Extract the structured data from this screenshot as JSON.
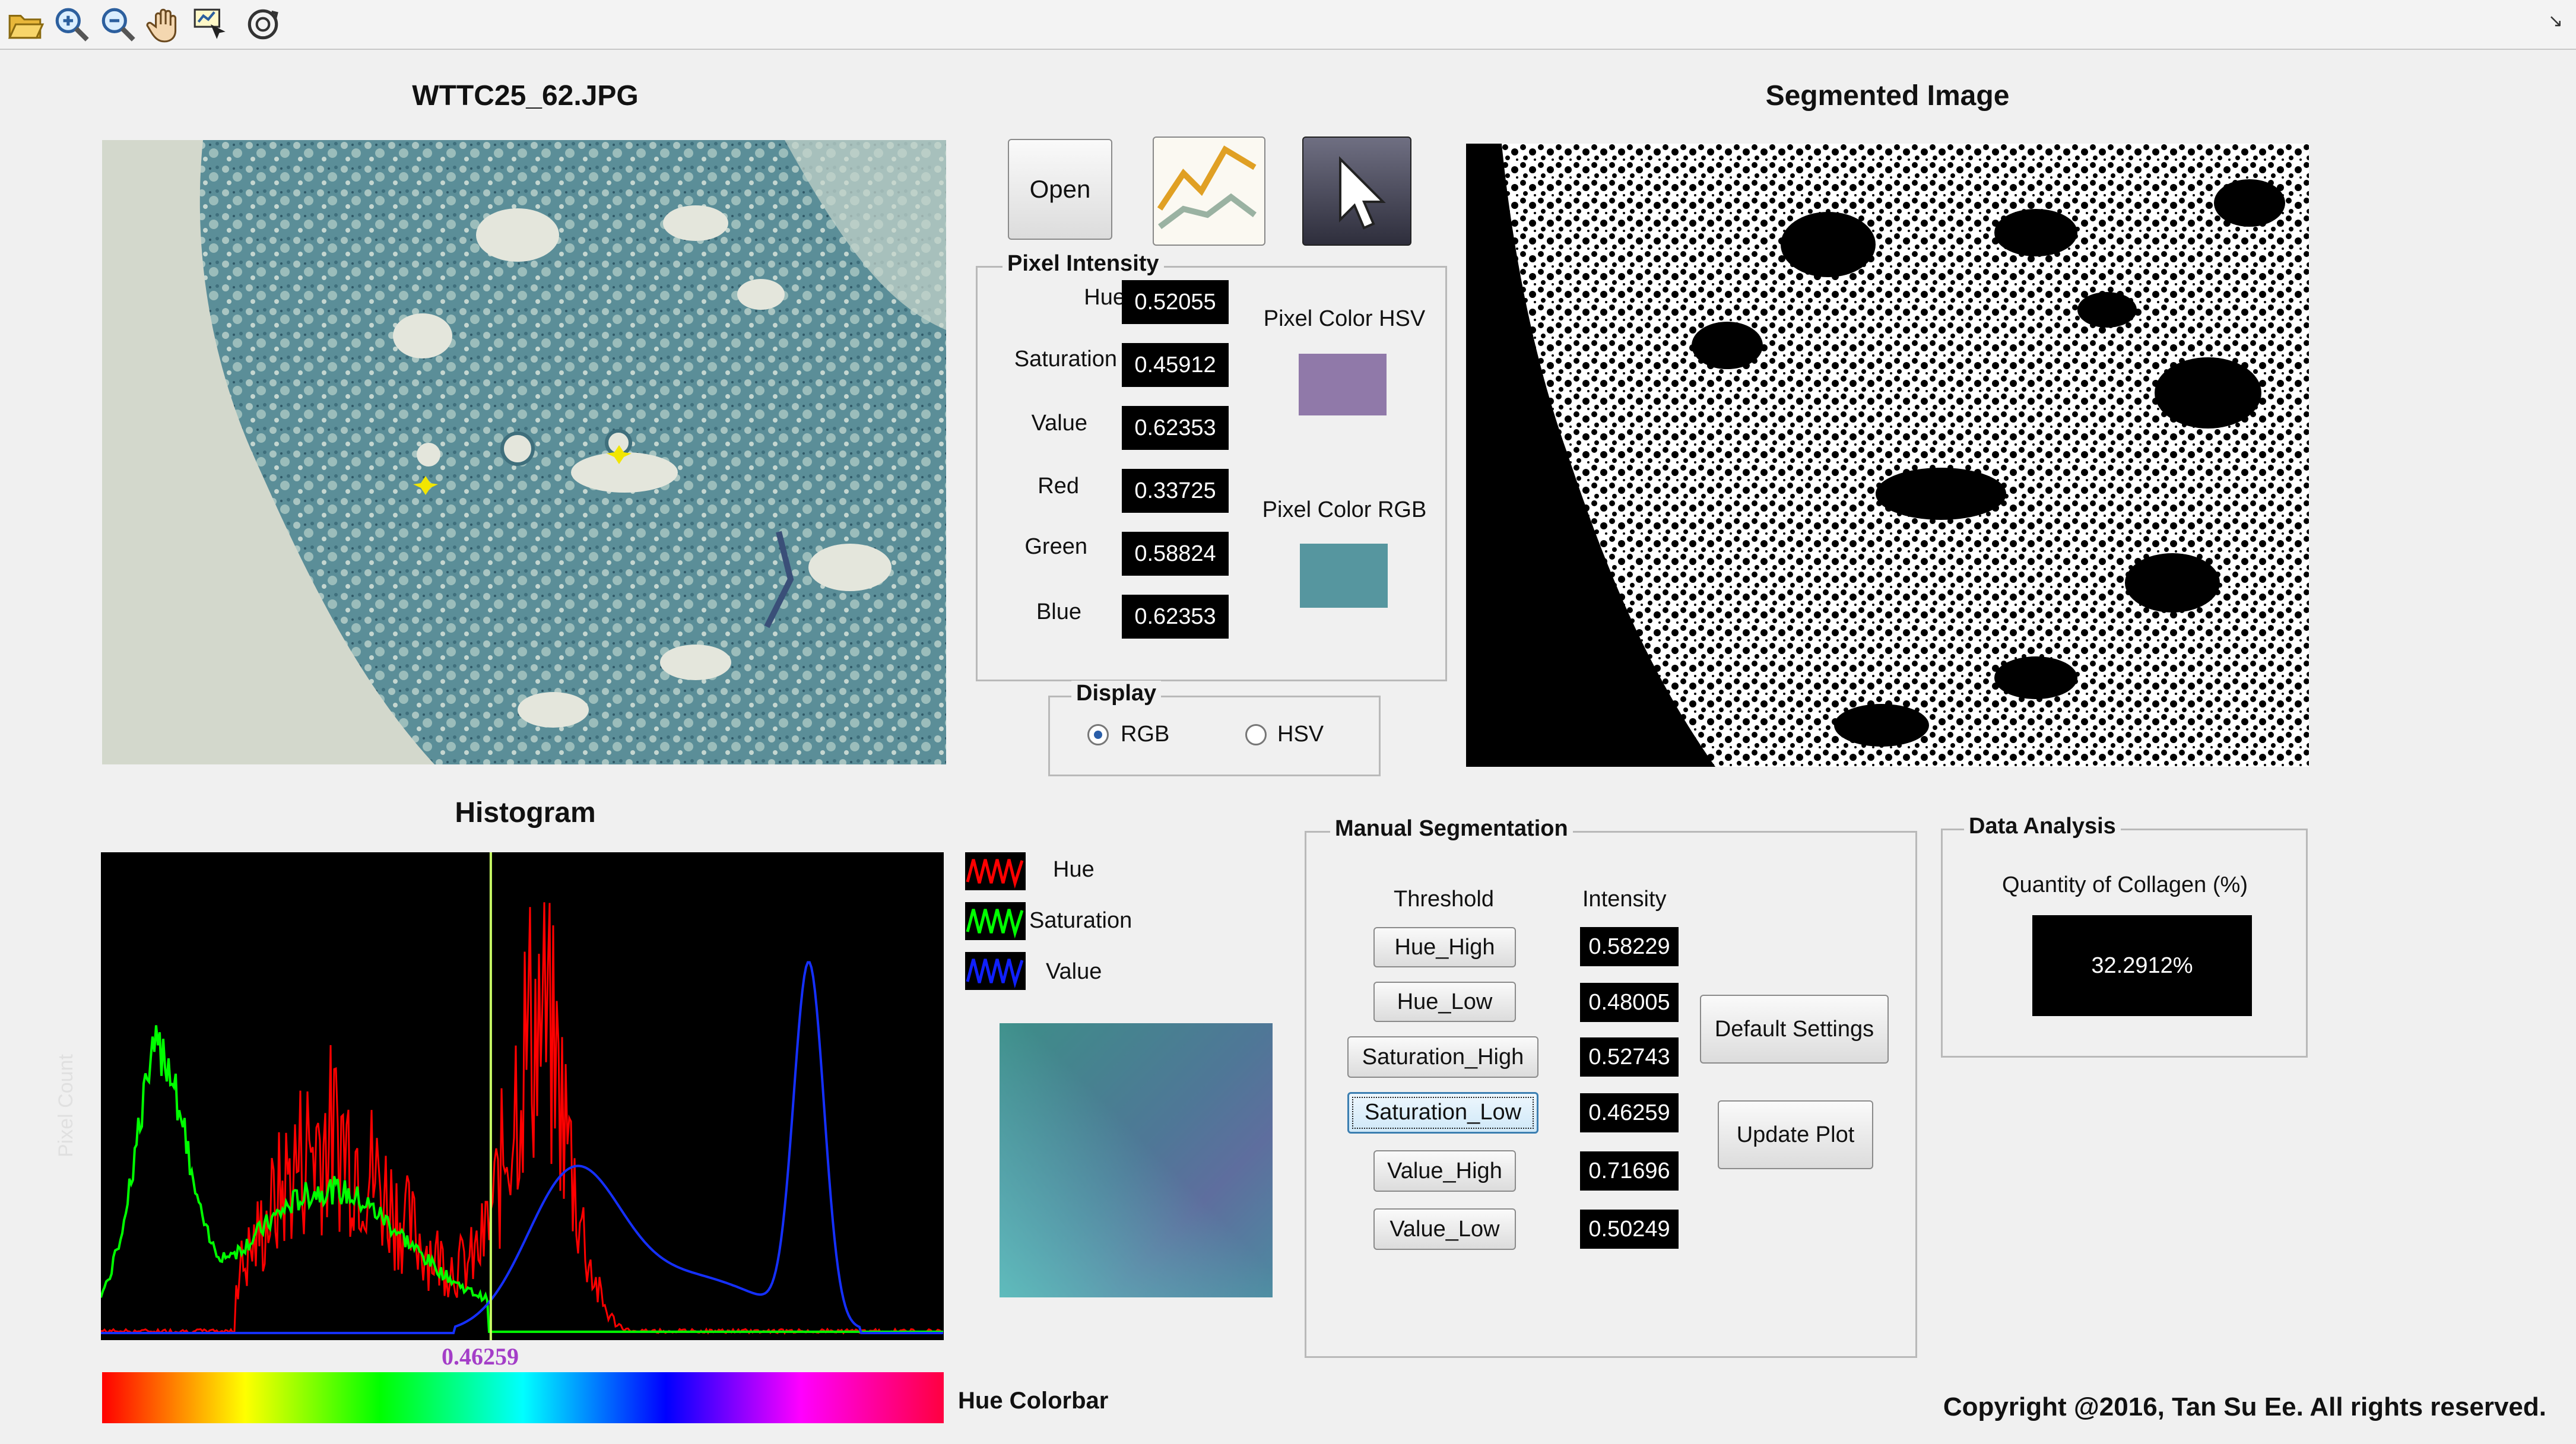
{
  "toolbar": {
    "icons": [
      "open-folder-icon",
      "zoom-in-icon",
      "zoom-out-icon",
      "pan-hand-icon",
      "data-cursor-icon",
      "rotate-3d-icon"
    ]
  },
  "original_image": {
    "title": "WTTC25_62.JPG"
  },
  "segmented_image": {
    "title": "Segmented Image"
  },
  "buttons": {
    "open_label": "Open"
  },
  "pixel_intensity": {
    "title": "Pixel Intensity",
    "rows": [
      {
        "label": "Hue",
        "value": "0.52055"
      },
      {
        "label": "Saturation",
        "value": "0.45912"
      },
      {
        "label": "Value",
        "value": "0.62353"
      },
      {
        "label": "Red",
        "value": "0.33725"
      },
      {
        "label": "Green",
        "value": "0.58824"
      },
      {
        "label": "Blue",
        "value": "0.62353"
      }
    ],
    "hsv_label": "Pixel Color HSV",
    "hsv_color": "#9079a9",
    "rgb_label": "Pixel Color RGB",
    "rgb_color": "#56969f"
  },
  "display": {
    "title": "Display",
    "option_rgb": "RGB",
    "option_hsv": "HSV",
    "selected": "RGB"
  },
  "histogram": {
    "title": "Histogram",
    "ylabel": "Pixel Count",
    "marker_value": "0.46259",
    "colorbar_label": "Hue Colorbar"
  },
  "legend": {
    "items": [
      {
        "name": "Hue",
        "color": "#ff0000"
      },
      {
        "name": "Saturation",
        "color": "#00ff00"
      },
      {
        "name": "Value",
        "color": "#0000ff"
      }
    ]
  },
  "manual_segmentation": {
    "title": "Manual Segmentation",
    "col_threshold": "Threshold",
    "col_intensity": "Intensity",
    "rows": [
      {
        "label": "Hue_High",
        "value": "0.58229"
      },
      {
        "label": "Hue_Low",
        "value": "0.48005"
      },
      {
        "label": "Saturation_High",
        "value": "0.52743"
      },
      {
        "label": "Saturation_Low",
        "value": "0.46259"
      },
      {
        "label": "Value_High",
        "value": "0.71696"
      },
      {
        "label": "Value_Low",
        "value": "0.50249"
      }
    ],
    "default_settings_label": "Default Settings",
    "update_plot_label": "Update Plot"
  },
  "data_analysis": {
    "title": "Data Analysis",
    "quantity_label": "Quantity of Collagen (%)",
    "quantity_value": "32.2912%"
  },
  "footer": {
    "copyright": "Copyright @2016, Tan Su Ee. All rights reserved."
  }
}
